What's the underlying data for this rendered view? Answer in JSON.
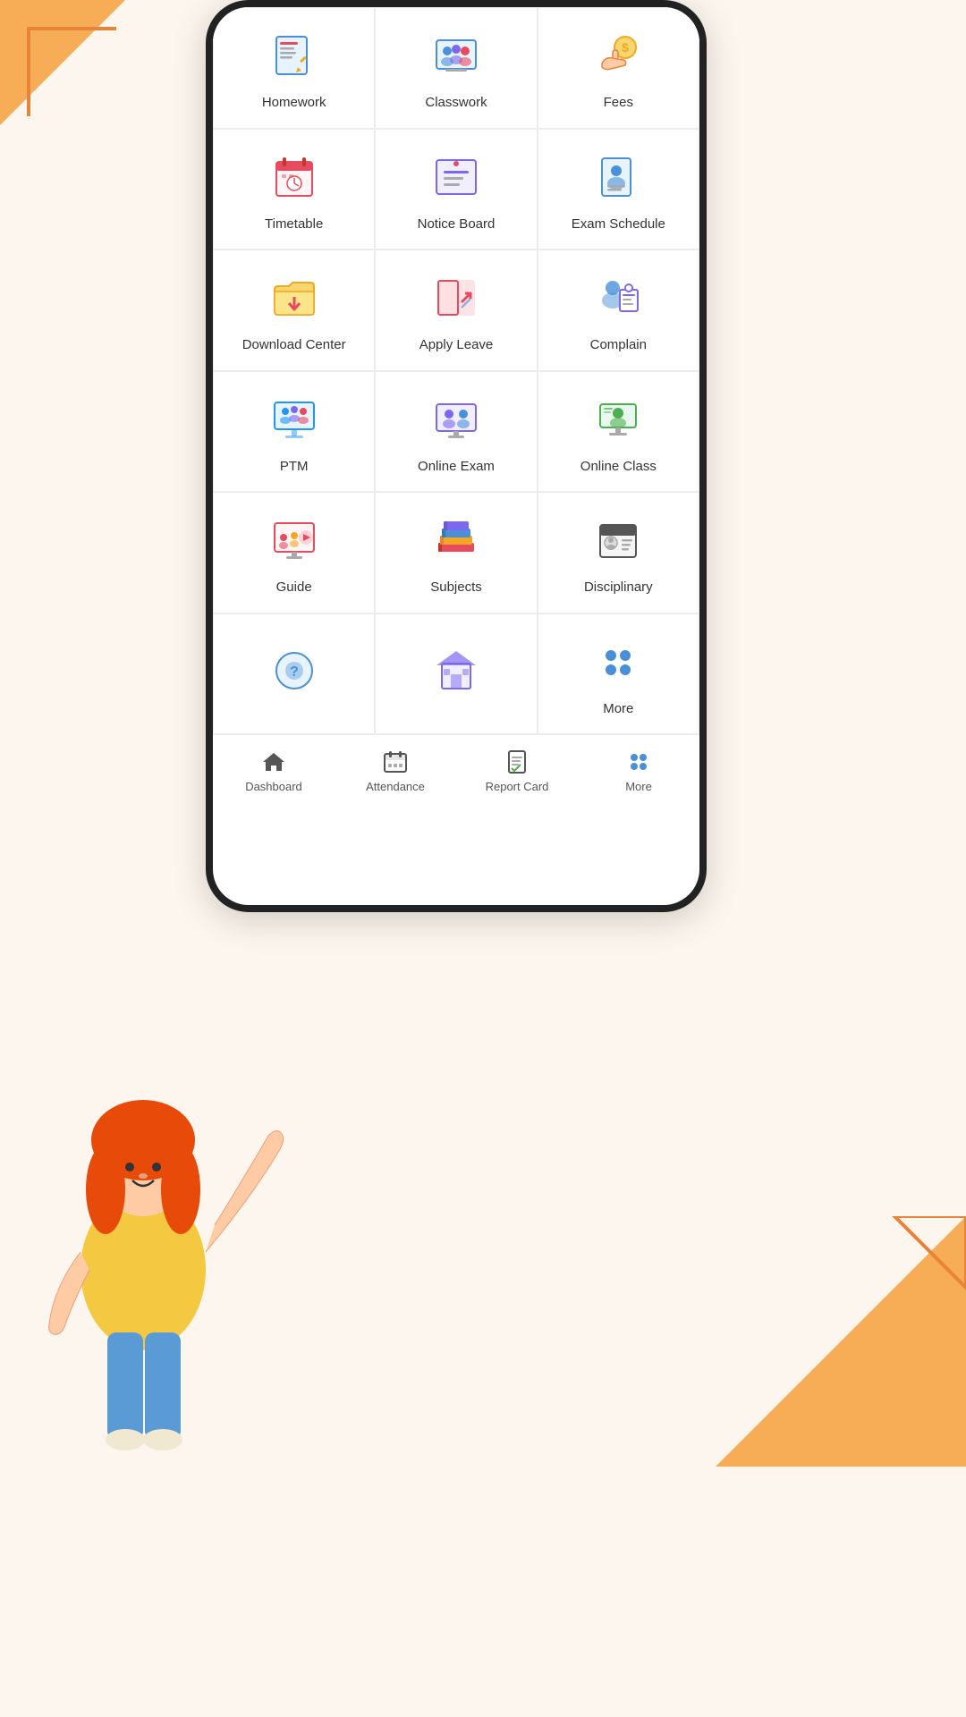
{
  "background": {
    "color": "#fdf6ee",
    "accent_color": "#f4a03a"
  },
  "grid_items": [
    {
      "id": "homework",
      "label": "Homework",
      "icon": "homework-icon",
      "icon_color": "#e84a5f"
    },
    {
      "id": "classwork",
      "label": "Classwork",
      "icon": "classwork-icon",
      "icon_color": "#4a90d9"
    },
    {
      "id": "fees",
      "label": "Fees",
      "icon": "fees-icon",
      "icon_color": "#f5a623"
    },
    {
      "id": "timetable",
      "label": "Timetable",
      "icon": "timetable-icon",
      "icon_color": "#e84a5f"
    },
    {
      "id": "notice-board",
      "label": "Notice Board",
      "icon": "notice-board-icon",
      "icon_color": "#7b68ee"
    },
    {
      "id": "exam-schedule",
      "label": "Exam Schedule",
      "icon": "exam-schedule-icon",
      "icon_color": "#4a90d9"
    },
    {
      "id": "download-center",
      "label": "Download Center",
      "icon": "download-center-icon",
      "icon_color": "#f5a623"
    },
    {
      "id": "apply-leave",
      "label": "Apply Leave",
      "icon": "apply-leave-icon",
      "icon_color": "#e84a5f"
    },
    {
      "id": "complain",
      "label": "Complain",
      "icon": "complain-icon",
      "icon_color": "#4a90d9"
    },
    {
      "id": "ptm",
      "label": "PTM",
      "icon": "ptm-icon",
      "icon_color": "#2196f3"
    },
    {
      "id": "online-exam",
      "label": "Online Exam",
      "icon": "online-exam-icon",
      "icon_color": "#7b68ee"
    },
    {
      "id": "online-class",
      "label": "Online Class",
      "icon": "online-class-icon",
      "icon_color": "#4caf50"
    },
    {
      "id": "guide",
      "label": "Guide",
      "icon": "guide-icon",
      "icon_color": "#e84a5f"
    },
    {
      "id": "subjects",
      "label": "Subjects",
      "icon": "subjects-icon",
      "icon_color": "#f5a623"
    },
    {
      "id": "disciplinary",
      "label": "Disciplinary",
      "icon": "disciplinary-icon",
      "icon_color": "#555"
    },
    {
      "id": "more-item-1",
      "label": "",
      "icon": "more-icon-1",
      "icon_color": "#4a90d9"
    },
    {
      "id": "more-item-2",
      "label": "",
      "icon": "more-icon-2",
      "icon_color": "#f5a623"
    },
    {
      "id": "more-top",
      "label": "More",
      "icon": "more-dots-icon",
      "icon_color": "#4a90d9"
    }
  ],
  "bottom_nav": [
    {
      "id": "dashboard",
      "label": "Dashboard",
      "icon": "home-icon"
    },
    {
      "id": "attendance",
      "label": "Attendance",
      "icon": "calendar-icon"
    },
    {
      "id": "report-card",
      "label": "Report Card",
      "icon": "report-icon"
    },
    {
      "id": "more",
      "label": "More",
      "icon": "grid-icon"
    }
  ]
}
